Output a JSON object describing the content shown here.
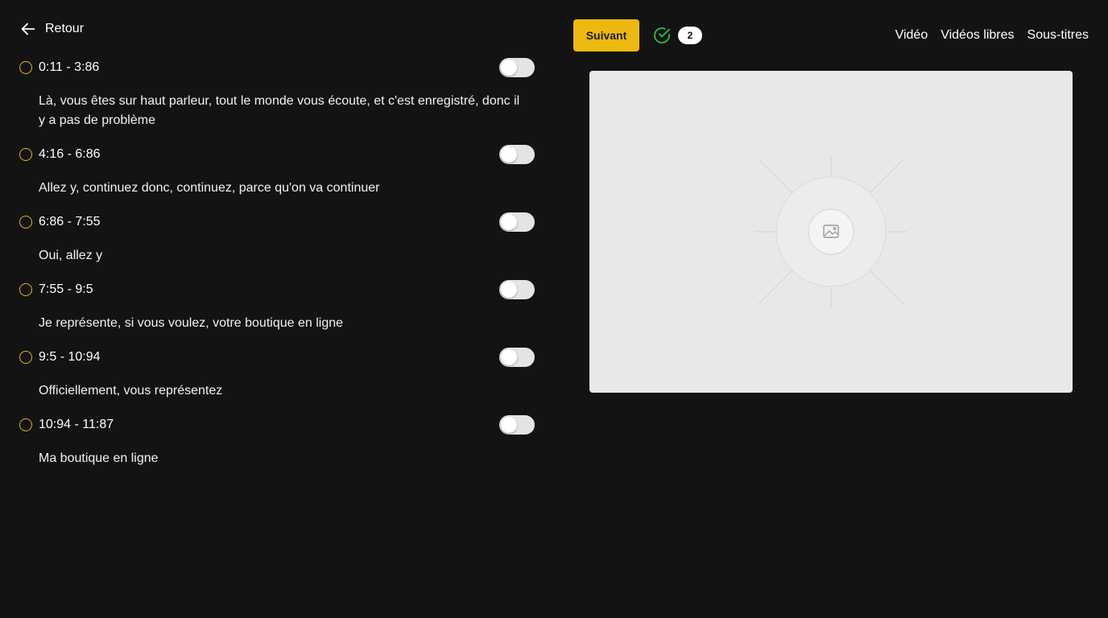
{
  "nav": {
    "back_label": "Retour",
    "next_label": "Suivant",
    "completed_count": "2",
    "tabs": [
      "Vidéo",
      "Vidéos libres",
      "Sous-titres"
    ]
  },
  "colors": {
    "background": "#131313",
    "accent": "#ecb90f",
    "status_pending": "#e8b31a",
    "check": "#27b24a"
  },
  "icons": {
    "back": "arrow-left-icon",
    "completed": "check-circle-icon",
    "preview": "image-placeholder-icon"
  },
  "segments": [
    {
      "time": "0:11 - 3:86",
      "text": "Là, vous êtes sur haut parleur, tout le monde vous écoute, et c'est enregistré, donc il y a pas de problème",
      "enabled": false
    },
    {
      "time": "4:16 - 6:86",
      "text": "Allez y, continuez donc, continuez, parce qu'on va continuer",
      "enabled": false
    },
    {
      "time": "6:86 - 7:55",
      "text": "Oui, allez y",
      "enabled": false
    },
    {
      "time": "7:55 - 9:5",
      "text": "Je représente, si vous voulez, votre boutique en ligne",
      "enabled": false
    },
    {
      "time": "9:5 - 10:94",
      "text": "Officiellement, vous représentez",
      "enabled": false
    },
    {
      "time": "10:94 - 11:87",
      "text": "Ma boutique en ligne",
      "enabled": false
    }
  ]
}
